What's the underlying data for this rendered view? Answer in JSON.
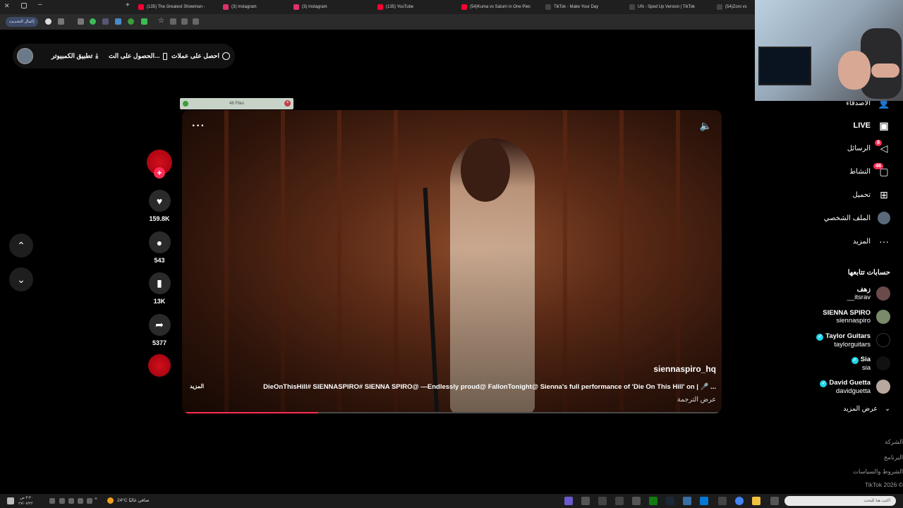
{
  "browser": {
    "tabs": [
      {
        "title": "(135) The Greatest Showman -",
        "fav_color": "#ff0033"
      },
      {
        "title": "(3) Instagram",
        "fav_color": "#e1306c"
      },
      {
        "title": "(3) Instagram",
        "fav_color": "#e1306c"
      },
      {
        "title": "(135) YouTube",
        "fav_color": "#ff0033"
      },
      {
        "title": "(54)Kuma vs Saturn in One Piec",
        "fav_color": "#000000"
      },
      {
        "title": "TikTok - Make Your Day",
        "fav_color": "#000000"
      },
      {
        "title": "UN - Sped Up Version | TikTok",
        "fav_color": "#000000"
      },
      {
        "title": "(54)Zoro vs",
        "fav_color": "#000000"
      }
    ],
    "update_button": "إكمال التحديث"
  },
  "topbar": {
    "coins_label": "احصل على عملات",
    "app_label": "الحصول على الت...",
    "desktop_label": "تطبيق الكمبيوتر"
  },
  "overlay": {
    "files_label": "48 Files"
  },
  "video": {
    "author": "siennaspiro_hq",
    "caption": "DieOnThisHill# SIENNASPIRO# SIENNA SPIRO@ —Endlessly proud@ FallonTonight@ Sienna's full performance of 'Die On This Hill' on | 🎤 ...",
    "caption_more": "المزيد",
    "translate": "عرض الترجمة",
    "progress": 0.25
  },
  "actions": {
    "likes": "159.8K",
    "comments": "543",
    "saves": "13K",
    "shares": "5377"
  },
  "sidebar": {
    "nav": [
      {
        "label": "الأصدقاء",
        "icon": "friends-icon"
      },
      {
        "label": "LIVE",
        "icon": "live-icon"
      },
      {
        "label": "الرسائل",
        "icon": "messages-icon",
        "badge": "8"
      },
      {
        "label": "النشاط",
        "icon": "activity-icon",
        "badge": "46"
      },
      {
        "label": "تحميل",
        "icon": "upload-icon"
      },
      {
        "label": "الملف الشخصي",
        "icon": "profile-icon"
      },
      {
        "label": "المزيد",
        "icon": "more-icon"
      }
    ],
    "following_title": "حسابات تتابعها",
    "following": [
      {
        "name": "زهف",
        "username": "__itsrav",
        "verified": false
      },
      {
        "name": "SIENNA SPIRO",
        "username": "siennaspiro",
        "verified": false
      },
      {
        "name": "Taylor Guitars",
        "username": "taylorguitars",
        "verified": true
      },
      {
        "name": "Sia",
        "username": "sia",
        "verified": true
      },
      {
        "name": "David Guetta",
        "username": "davidguetta",
        "verified": true
      }
    ],
    "see_more": "عرض المزيد",
    "footer": [
      "الشركة",
      "البرنامج",
      "الشروط والسياسات",
      "TikTok 2026 ©"
    ]
  },
  "taskbar": {
    "weather": "24°C  صافي غالبًا",
    "search_placeholder": "اكتب هنا للبحث",
    "time": "٣:٣٠ ص",
    "date": "٢٧/٠٧/٢٢"
  },
  "colors": {
    "accent": "#fe2c55",
    "verified": "#20d5ec"
  }
}
